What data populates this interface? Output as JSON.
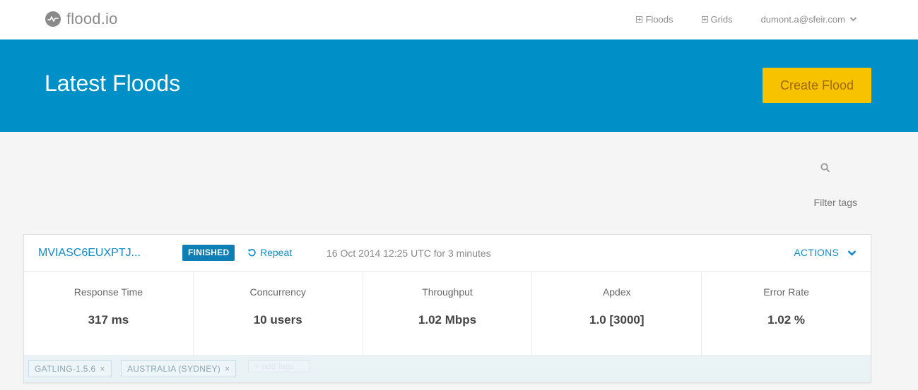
{
  "nav": {
    "brand": "flood.io",
    "links": [
      {
        "label": "Floods",
        "icon": "plus-square-icon"
      },
      {
        "label": "Grids",
        "icon": "plus-square-icon"
      }
    ],
    "user_email": "dumont.a@sfeir.com"
  },
  "hero": {
    "title": "Latest Floods",
    "create_button": "Create Flood"
  },
  "filter": {
    "placeholder": "Filter tags"
  },
  "flood": {
    "name": "MVIASC6EUXPTJ...",
    "status": "FINISHED",
    "repeat_label": "Repeat",
    "run_info": "16 Oct 2014 12:25 UTC for 3 minutes",
    "actions_label": "ACTIONS",
    "metrics": [
      {
        "label": "Response Time",
        "value": "317 ms"
      },
      {
        "label": "Concurrency",
        "value": "10 users"
      },
      {
        "label": "Throughput",
        "value": "1.02 Mbps"
      },
      {
        "label": "Apdex",
        "value": "1.0 [3000]"
      },
      {
        "label": "Error Rate",
        "value": "1.02 %"
      }
    ],
    "tags": [
      "GATLING-1.5.6",
      "AUSTRALIA (SYDNEY)"
    ],
    "add_tags_placeholder": "+ add tags"
  },
  "colors": {
    "hero_bg": "#0090c8",
    "create_button": "#f7c200",
    "link_blue": "#0d8ac7",
    "badge": "#0d7fb5"
  }
}
